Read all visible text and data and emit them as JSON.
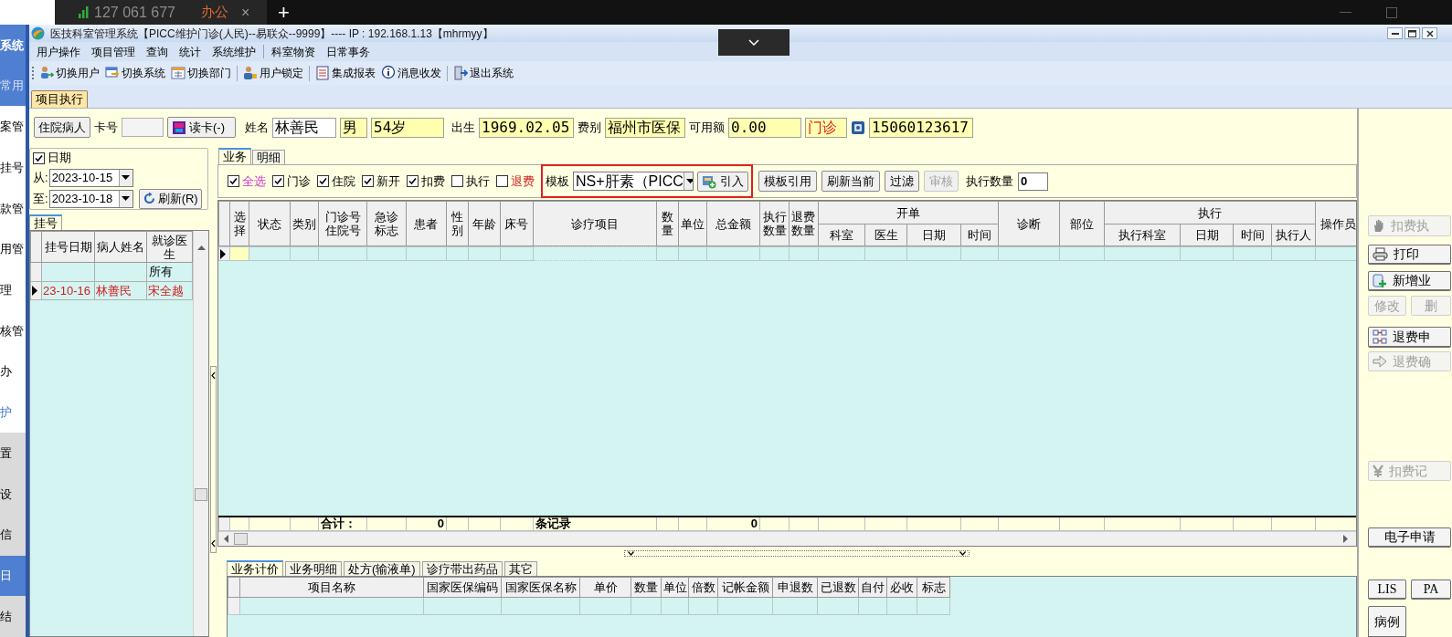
{
  "browser_tabs": {
    "signal_text": "127 061 677",
    "tab_label": "办公",
    "tab_close": "×",
    "new_tab": "+"
  },
  "side_strip": [
    {
      "label": "系统",
      "kind": "title",
      "selected": false
    },
    {
      "label": "常用",
      "kind": "header",
      "selected": false
    },
    {
      "label": "案管",
      "kind": "item",
      "selected": false
    },
    {
      "label": "挂号",
      "kind": "item",
      "selected": false
    },
    {
      "label": "款管",
      "kind": "item",
      "selected": false
    },
    {
      "label": "用管",
      "kind": "item",
      "selected": false
    },
    {
      "label": "理",
      "kind": "item",
      "selected": false
    },
    {
      "label": "核管",
      "kind": "item",
      "selected": false
    },
    {
      "label": "办",
      "kind": "item",
      "selected": false
    },
    {
      "label": "护",
      "kind": "link",
      "selected": false
    },
    {
      "label": "置",
      "kind": "grey",
      "selected": false
    },
    {
      "label": "设",
      "kind": "grey",
      "selected": false
    },
    {
      "label": "信",
      "kind": "grey",
      "selected": false
    },
    {
      "label": "日",
      "kind": "grey",
      "selected": true
    },
    {
      "label": "结",
      "kind": "grey",
      "selected": false
    }
  ],
  "window": {
    "title": "医技科室管理系统【PICC维护门诊(人民)--易联众--9999】---- IP : 192.168.1.13【mhrmyy】"
  },
  "menu": [
    "用户操作",
    "项目管理",
    "查询",
    "统计",
    "系统维护",
    "科室物资",
    "日常事务"
  ],
  "toolbar": [
    "切换用户",
    "切换系统",
    "切换部门",
    "用户锁定",
    "集成报表",
    "消息收发",
    "退出系统"
  ],
  "page_tab": {
    "label": "项目执行",
    "selected": true
  },
  "patient": {
    "type_button": "住院病人",
    "card_label": "卡号",
    "read_card_button": "读卡(-)",
    "name_label": "姓名",
    "name": "林善民",
    "sex": "男",
    "age": "54岁",
    "birth_label": "出生",
    "birth": "1969.02.05",
    "fee_label": "费别",
    "fee_type": "福州市医保",
    "balance_label": "可用额",
    "balance": "0.00",
    "visit_type": "门诊",
    "phone": "15060123617"
  },
  "date_filter": {
    "label": "日期",
    "checked": true,
    "from_label": "从:",
    "from": "2023-10-15",
    "to_label": "至:",
    "to": "2023-10-18",
    "refresh_button": "刷新(R)"
  },
  "registration": {
    "tab": "挂号",
    "columns": [
      "挂号日期",
      "病人姓名",
      "就诊医生"
    ],
    "filter_value": "所有",
    "rows": [
      {
        "date": "23-10-16",
        "patient": "林善民",
        "doctor": "宋全越",
        "current": true
      }
    ]
  },
  "business_tabs": [
    {
      "label": "业务",
      "selected": true
    },
    {
      "label": "明细",
      "selected": false
    }
  ],
  "filters": [
    {
      "label": "全选",
      "checked": true,
      "kind": "select_all"
    },
    {
      "label": "门诊",
      "checked": true,
      "kind": "normal"
    },
    {
      "label": "住院",
      "checked": true,
      "kind": "normal"
    },
    {
      "label": "新开",
      "checked": true,
      "kind": "normal"
    },
    {
      "label": "扣费",
      "checked": true,
      "kind": "normal"
    },
    {
      "label": "执行",
      "checked": false,
      "kind": "normal"
    },
    {
      "label": "退费",
      "checked": false,
      "kind": "refund"
    }
  ],
  "template": {
    "label": "模板",
    "value": "NS+肝素（PICC",
    "import_button": "引入",
    "highlighted": true
  },
  "actions": [
    {
      "label": "模板引用",
      "disabled": false
    },
    {
      "label": "刷新当前",
      "disabled": false
    },
    {
      "label": "过滤",
      "disabled": false
    },
    {
      "label": "审核",
      "disabled": true
    }
  ],
  "exec_count": {
    "label": "执行数量",
    "value": "0"
  },
  "main_table": {
    "columns": [
      {
        "label": "选择"
      },
      {
        "label": "状态"
      },
      {
        "label": "类别"
      },
      {
        "label": "门诊号住院号"
      },
      {
        "label": "急诊标志"
      },
      {
        "label": "患者"
      },
      {
        "label": "性别"
      },
      {
        "label": "年龄"
      },
      {
        "label": "床号"
      },
      {
        "label": "诊疗项目"
      },
      {
        "label": "数量"
      },
      {
        "label": "单位"
      },
      {
        "label": "总金额"
      },
      {
        "label": "执行数量"
      },
      {
        "label": "退费数量"
      },
      {
        "label": "开单",
        "children": [
          {
            "label": "科室"
          },
          {
            "label": "医生"
          },
          {
            "label": "日期"
          },
          {
            "label": "时间"
          }
        ]
      },
      {
        "label": "诊断"
      },
      {
        "label": "部位"
      },
      {
        "label": "执行",
        "children": [
          {
            "label": "执行科室"
          },
          {
            "label": "日期"
          },
          {
            "label": "时间"
          },
          {
            "label": "执行人"
          }
        ]
      },
      {
        "label": "操作员"
      }
    ],
    "rows": [
      {
        "current": true
      }
    ],
    "footer": {
      "total_label": "合计：",
      "patient_count": "0",
      "records_label": "条记录",
      "amount_total": "0"
    }
  },
  "detail_tabs": [
    {
      "label": "业务计价",
      "selected": true
    },
    {
      "label": "业务明细",
      "selected": false
    },
    {
      "label": "处方(输液单)",
      "selected": false
    },
    {
      "label": "诊疗带出药品",
      "selected": false
    },
    {
      "label": "其它",
      "selected": false
    }
  ],
  "detail_table": {
    "columns": [
      "项目名称",
      "国家医保编码",
      "国家医保名称",
      "单价",
      "数量",
      "单位",
      "倍数",
      "记帐金额",
      "申退数",
      "已退数",
      "自付",
      "必收",
      "标志"
    ]
  },
  "side_panel": {
    "rows": [
      {
        "buttons": [
          {
            "label": "扣费执",
            "disabled": true
          }
        ]
      },
      {
        "buttons": [
          {
            "label": "打印",
            "disabled": false
          }
        ]
      },
      {
        "buttons": [
          {
            "label": "新增业",
            "disabled": false
          }
        ]
      },
      {
        "buttons": [
          {
            "label": "修改",
            "disabled": true
          },
          {
            "label": "删",
            "disabled": true
          }
        ]
      },
      {
        "buttons": [
          {
            "label": "退费申",
            "disabled": false
          }
        ]
      },
      {
        "buttons": [
          {
            "label": "退费确",
            "disabled": true
          }
        ]
      },
      {
        "buttons": [
          {
            "label": "扣费记",
            "disabled": true
          }
        ]
      },
      {
        "buttons": [
          {
            "label": "电子申请",
            "disabled": false
          }
        ]
      },
      {
        "buttons": [
          {
            "label": "LIS",
            "disabled": false
          },
          {
            "label": "PA",
            "disabled": false
          }
        ]
      },
      {
        "buttons": [
          {
            "label": "病例",
            "disabled": false
          }
        ]
      }
    ]
  }
}
